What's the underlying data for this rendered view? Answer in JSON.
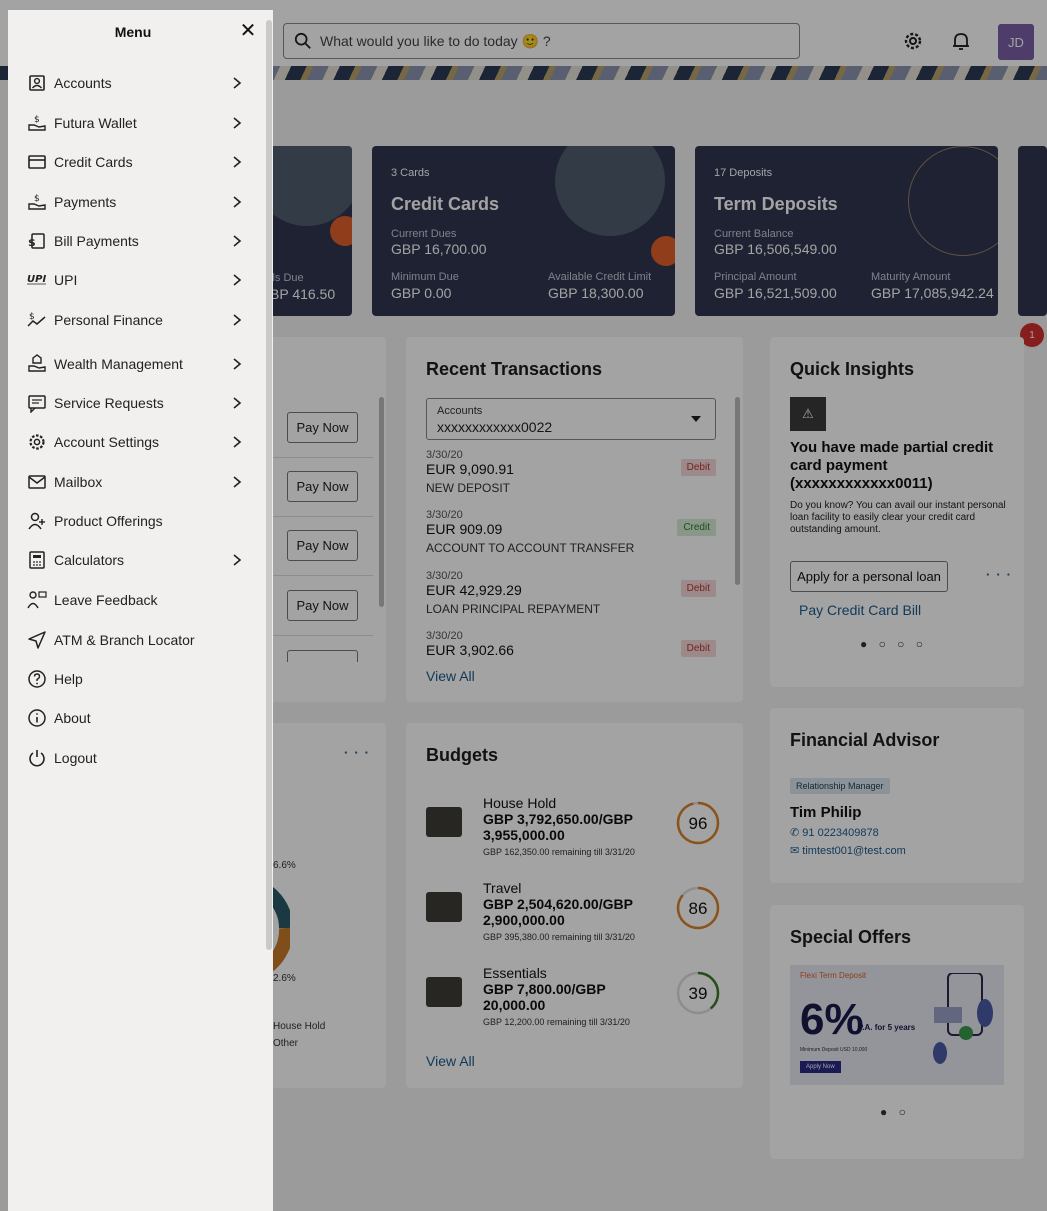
{
  "menu": {
    "title": "Menu",
    "items": [
      {
        "label": "Accounts",
        "icon": "accounts-icon",
        "chevron": true
      },
      {
        "label": "Futura Wallet",
        "icon": "wallet-icon",
        "chevron": true
      },
      {
        "label": "Credit Cards",
        "icon": "credit-card-icon",
        "chevron": true
      },
      {
        "label": "Payments",
        "icon": "payments-icon",
        "chevron": true
      },
      {
        "label": "Bill Payments",
        "icon": "bill-payments-icon",
        "chevron": true
      },
      {
        "label": "UPI",
        "icon": "upi-icon",
        "chevron": true
      },
      {
        "label": "Personal Finance",
        "icon": "personal-finance-icon",
        "chevron": true
      },
      {
        "label": "Wealth Management",
        "icon": "wealth-icon",
        "chevron": true
      },
      {
        "label": "Service Requests",
        "icon": "service-requests-icon",
        "chevron": true
      },
      {
        "label": "Account Settings",
        "icon": "settings-icon",
        "chevron": true
      },
      {
        "label": "Mailbox",
        "icon": "mail-icon",
        "chevron": true
      },
      {
        "label": "Product Offerings",
        "icon": "product-offerings-icon",
        "chevron": false
      },
      {
        "label": "Calculators",
        "icon": "calculator-icon",
        "chevron": true
      },
      {
        "label": "Leave Feedback",
        "icon": "feedback-icon",
        "chevron": false
      },
      {
        "label": "ATM & Branch Locator",
        "icon": "locator-icon",
        "chevron": false
      },
      {
        "label": "Help",
        "icon": "help-icon",
        "chevron": false
      },
      {
        "label": "About",
        "icon": "info-icon",
        "chevron": false
      },
      {
        "label": "Logout",
        "icon": "power-icon",
        "chevron": false
      }
    ]
  },
  "header": {
    "search_placeholder": "What would you like to do today 🙂 ?",
    "avatar_initials": "JD"
  },
  "summary_cards": {
    "loans_partial": {
      "label": "lls Due",
      "value": "BP 416.50"
    },
    "credit_cards": {
      "count": "3 Cards",
      "title": "Credit Cards",
      "current_dues_label": "Current Dues",
      "current_dues": "GBP 16,700.00",
      "minimum_due_label": "Minimum Due",
      "minimum_due": "GBP 0.00",
      "available_limit_label": "Available Credit Limit",
      "available_limit": "GBP 18,300.00"
    },
    "term_deposits": {
      "count": "17 Deposits",
      "title": "Term Deposits",
      "current_balance_label": "Current Balance",
      "current_balance": "GBP 16,506,549.00",
      "principal_label": "Principal Amount",
      "principal": "GBP 16,521,509.00",
      "maturity_label": "Maturity Amount",
      "maturity": "GBP 17,085,942.24"
    }
  },
  "upcoming_payments": {
    "pay_now_label": "Pay Now"
  },
  "recent_transactions": {
    "title": "Recent Transactions",
    "account_label": "Accounts",
    "account_value": "xxxxxxxxxxxx0022",
    "rows": [
      {
        "date": "3/30/20",
        "amount": "EUR 9,090.91",
        "desc": "NEW DEPOSIT",
        "type": "Debit"
      },
      {
        "date": "3/30/20",
        "amount": "EUR 909.09",
        "desc": "ACCOUNT TO ACCOUNT TRANSFER",
        "type": "Credit"
      },
      {
        "date": "3/30/20",
        "amount": "EUR 42,929.29",
        "desc": "LOAN PRINCIPAL REPAYMENT",
        "type": "Debit"
      },
      {
        "date": "3/30/20",
        "amount": "EUR 3,902.66",
        "desc": "",
        "type": "Debit"
      }
    ],
    "view_all": "View All"
  },
  "spends": {
    "pct_top": "6.6%",
    "pct_bottom": "2.6%",
    "legend": [
      "House Hold",
      "Other"
    ],
    "more": "···"
  },
  "budgets": {
    "title": "Budgets",
    "items": [
      {
        "name": "House Hold",
        "amount": "GBP 3,792,650.00/GBP 3,955,000.00",
        "remaining": "GBP 162,350.00 remaining till 3/31/20",
        "percent": "96",
        "percent_value": 96
      },
      {
        "name": "Travel",
        "amount": "GBP 2,504,620.00/GBP 2,900,000.00",
        "remaining": "GBP 395,380.00 remaining till 3/31/20",
        "percent": "86",
        "percent_value": 86
      },
      {
        "name": "Essentials",
        "amount": "GBP 7,800.00/GBP 20,000.00",
        "remaining": "GBP 12,200.00 remaining till 3/31/20",
        "percent": "39",
        "percent_value": 39
      }
    ],
    "view_all": "View All"
  },
  "quick_insights": {
    "title": "Quick Insights",
    "heading": "You have made partial credit card payment (xxxxxxxxxxxx0011)",
    "body": "Do you know? You can avail our instant personal loan facility to easily clear your credit card outstanding amount.",
    "cta": "Apply for a personal loan",
    "more": "···",
    "link": "Pay Credit Card Bill",
    "pager": "● ○ ○ ○"
  },
  "financial_advisor": {
    "title": "Financial Advisor",
    "role": "Relationship Manager",
    "name": "Tim Philip",
    "phone": "91 0223409878",
    "email": "timtest001@test.com"
  },
  "special_offers": {
    "title": "Special Offers",
    "offer_name": "Flexi Term Deposit",
    "rate": "6%",
    "rate_suffix": "P.A. for 5 years",
    "min_deposit": "Minimum Deposit USD 10,000",
    "cta": "Apply Now",
    "pager": "● ○"
  },
  "notification_count": "1",
  "colors": {
    "card_bg": "#2f3650",
    "accent_orange": "#e0602b",
    "link_blue": "#1b5b8c",
    "debit": "#b33333",
    "credit": "#2c7a2c",
    "ring_orange": "#d9822b",
    "ring_green": "#3c7a2a",
    "avatar": "#7b5ea7"
  }
}
